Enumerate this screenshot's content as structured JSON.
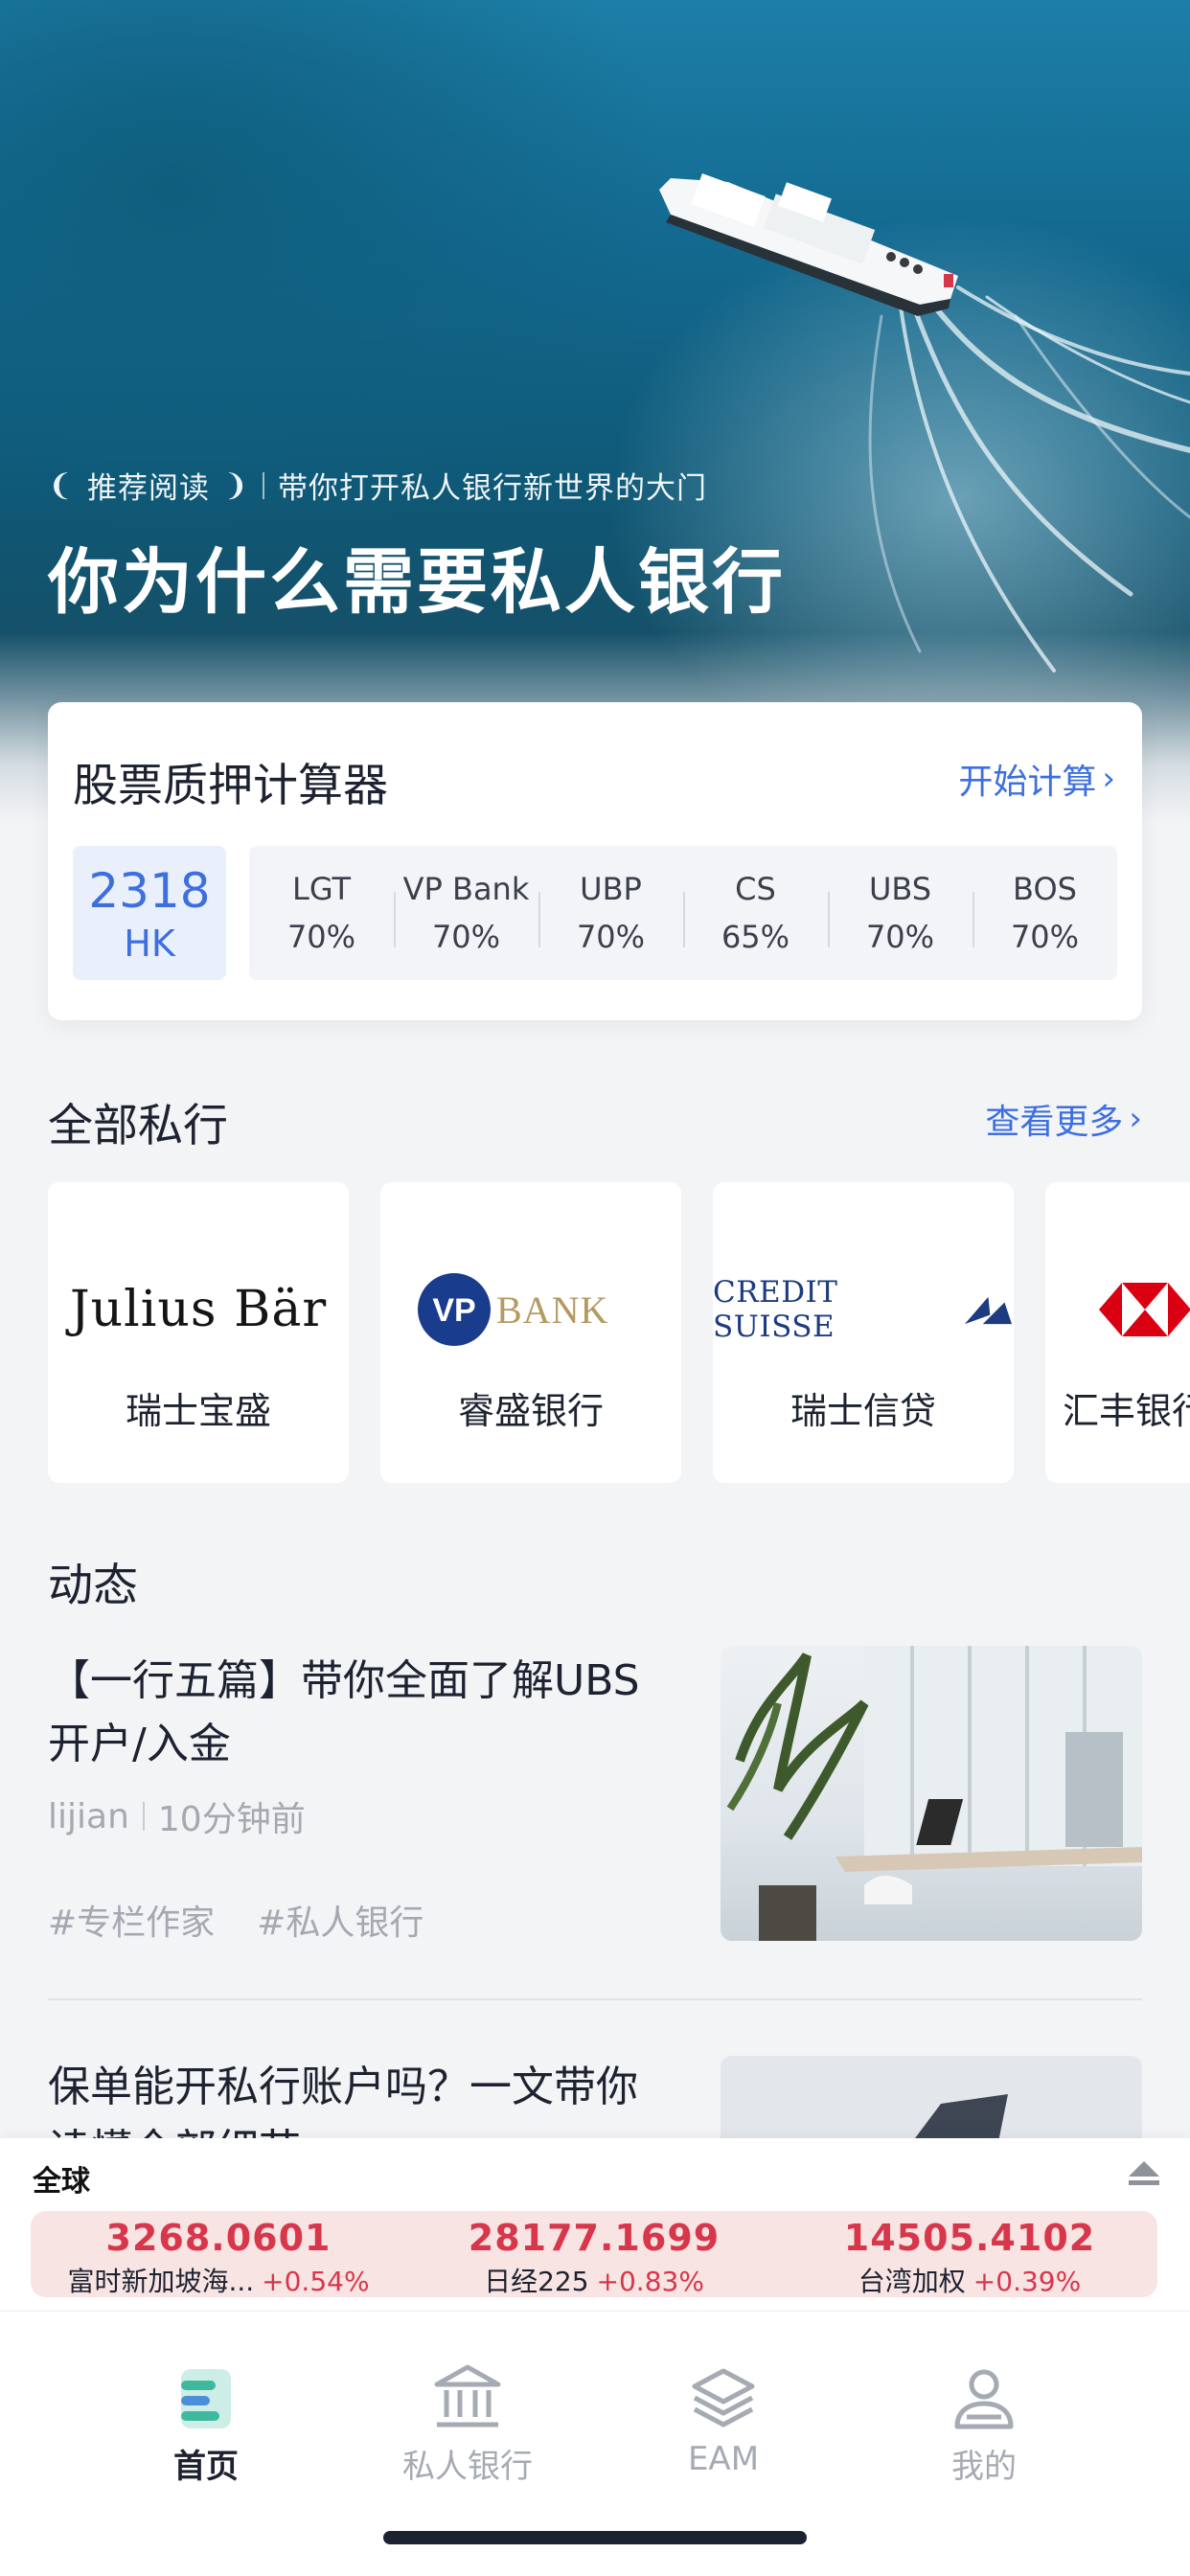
{
  "hero": {
    "kicker_tag": "推荐阅读",
    "kicker_text": "带你打开私人银行新世界的大门",
    "title": "你为什么需要私人银行"
  },
  "calculator": {
    "title": "股票质押计算器",
    "action": "开始计算",
    "stock": {
      "code": "2318",
      "market": "HK"
    },
    "rates": [
      {
        "bank": "LGT",
        "pct": "70%"
      },
      {
        "bank": "VP Bank",
        "pct": "70%"
      },
      {
        "bank": "UBP",
        "pct": "70%"
      },
      {
        "bank": "CS",
        "pct": "65%"
      },
      {
        "bank": "UBS",
        "pct": "70%"
      },
      {
        "bank": "BOS",
        "pct": "70%"
      }
    ]
  },
  "banks": {
    "title": "全部私行",
    "more": "查看更多",
    "items": [
      {
        "logo_text": "Julius Bär",
        "name": "瑞士宝盛"
      },
      {
        "logo_text": "BANK",
        "logo_mark": "VP",
        "name": "睿盛银行"
      },
      {
        "logo_text": "CREDIT SUISSE",
        "name": "瑞士信贷"
      },
      {
        "name": "汇丰银行"
      }
    ]
  },
  "feed": {
    "title": "动态",
    "items": [
      {
        "title": "【一行五篇】带你全面了解UBS开户/入金",
        "author": "lijian",
        "time": "10分钟前",
        "tags": [
          "#专栏作家",
          "#私人银行"
        ]
      },
      {
        "title": "保单能开私行账户吗？一文带你读懂全部细节"
      }
    ]
  },
  "ticker": {
    "label": "全球",
    "indices": [
      {
        "value": "3268.0601",
        "name": "富时新加坡海...",
        "change": "+0.54%"
      },
      {
        "value": "28177.1699",
        "name": "日经225",
        "change": "+0.83%"
      },
      {
        "value": "14505.4102",
        "name": "台湾加权",
        "change": "+0.39%"
      }
    ]
  },
  "tabs": [
    {
      "label": "首页",
      "icon": "home-icon",
      "active": true
    },
    {
      "label": "私人银行",
      "icon": "bank-icon",
      "active": false
    },
    {
      "label": "EAM",
      "icon": "layers-icon",
      "active": false
    },
    {
      "label": "我的",
      "icon": "user-icon",
      "active": false
    }
  ],
  "colors": {
    "accent": "#3d6fe0",
    "up_red": "#d8364a",
    "ticker_bg": "#f8e4e3"
  }
}
